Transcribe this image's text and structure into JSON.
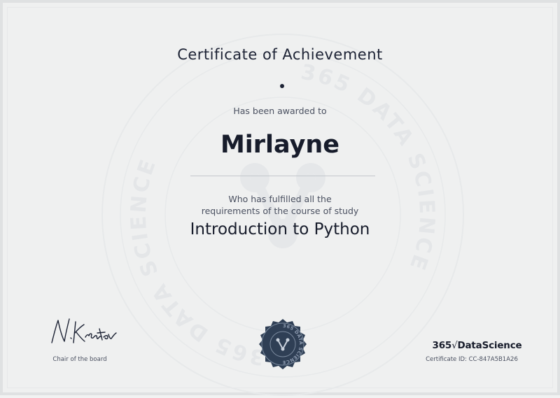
{
  "certificate": {
    "title": "Certificate of Achievement",
    "awarded_text": "Has been awarded to",
    "recipient": "Mirlayne",
    "fulfilled_line1": "Who has fulfilled all the",
    "fulfilled_line2": "requirements of the course of study",
    "course": "Introduction to Python"
  },
  "signature": {
    "text": "N.Krastev",
    "role": "Chair of the board"
  },
  "watermark": {
    "text": "365 DATA SCIENCE"
  },
  "brand": {
    "prefix": "365",
    "check": "√",
    "name": "DataScience"
  },
  "certificate_id_label": "Certificate ID: CC-847A5B1A26",
  "colors": {
    "text_dark": "#1b2234",
    "seal": "#2f3f55",
    "background": "#eff0f0"
  }
}
